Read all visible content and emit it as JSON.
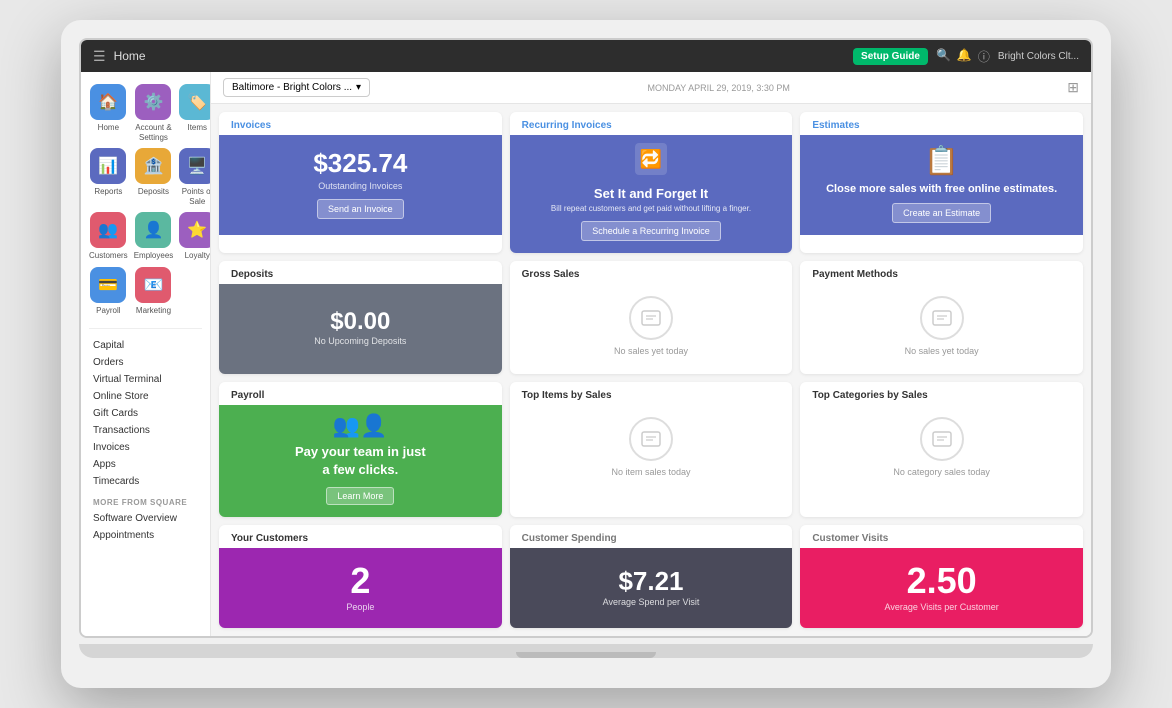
{
  "topbar": {
    "title": "Home",
    "setup_guide": "Setup Guide",
    "user": "Bright Colors Clt..."
  },
  "sidebar": {
    "nav_items": [
      {
        "id": "home",
        "label": "Home",
        "color": "#4a90e2",
        "icon": "🏠"
      },
      {
        "id": "account",
        "label": "Account & Settings",
        "color": "#9c5fbf",
        "icon": "⚙️"
      },
      {
        "id": "items",
        "label": "Items",
        "color": "#5bb8d4",
        "icon": "🏷️"
      },
      {
        "id": "reports",
        "label": "Reports",
        "color": "#5b6abf",
        "icon": "📊"
      },
      {
        "id": "deposits",
        "label": "Deposits",
        "color": "#e8a838",
        "icon": "🏦"
      },
      {
        "id": "pointsofsale",
        "label": "Points of Sale",
        "color": "#5b6abf",
        "icon": "🖥️"
      },
      {
        "id": "customers",
        "label": "Customers",
        "color": "#e05a6e",
        "icon": "👥"
      },
      {
        "id": "employees",
        "label": "Employees",
        "color": "#5bb8a0",
        "icon": "👤"
      },
      {
        "id": "loyalty",
        "label": "Loyalty",
        "color": "#9c5fbf",
        "icon": "⭐"
      },
      {
        "id": "payroll",
        "label": "Payroll",
        "color": "#4a90e2",
        "icon": "💳"
      },
      {
        "id": "marketing",
        "label": "Marketing",
        "color": "#e05a6e",
        "icon": "📧"
      }
    ],
    "links": [
      "Capital",
      "Orders",
      "Virtual Terminal",
      "Online Store",
      "Gift Cards",
      "Transactions",
      "Invoices",
      "Apps",
      "Timecards"
    ],
    "more_section": "MORE FROM SQUARE",
    "more_links": [
      "Software Overview",
      "Appointments"
    ]
  },
  "header": {
    "location": "Baltimore - Bright Colors ...",
    "date": "MONDAY APRIL 29, 2019, 3:30 PM"
  },
  "cards": {
    "invoices": {
      "title": "Invoices",
      "amount": "$325.74",
      "subtitle": "Outstanding Invoices",
      "button": "Send an Invoice"
    },
    "recurring": {
      "title": "Recurring Invoices",
      "heading": "Set It and Forget It",
      "text": "Bill repeat customers and get paid without lifting a finger.",
      "button": "Schedule a Recurring Invoice"
    },
    "estimates": {
      "title": "Estimates",
      "text": "Close more sales with free online estimates.",
      "button": "Create an Estimate"
    },
    "deposits": {
      "title": "Deposits",
      "amount": "$0.00",
      "subtitle": "No Upcoming Deposits"
    },
    "gross_sales": {
      "title": "Gross Sales",
      "no_sales": "No sales yet today"
    },
    "payment_methods": {
      "title": "Payment Methods",
      "no_sales": "No sales yet today"
    },
    "payroll": {
      "title": "Payroll",
      "text_line1": "Pay your team in just",
      "text_line2": "a few clicks.",
      "button": "Learn More"
    },
    "top_items": {
      "title": "Top Items by Sales",
      "no_sales": "No item sales today"
    },
    "top_categories": {
      "title": "Top Categories by Sales",
      "no_sales": "No category sales today"
    },
    "your_customers": {
      "title": "Your Customers",
      "number": "2",
      "subtitle": "People"
    },
    "customer_spending": {
      "title": "Customer Spending",
      "amount": "$7.21",
      "subtitle": "Average Spend per Visit"
    },
    "customer_visits": {
      "title": "Customer Visits",
      "number": "2.50",
      "subtitle": "Average Visits per Customer"
    }
  }
}
